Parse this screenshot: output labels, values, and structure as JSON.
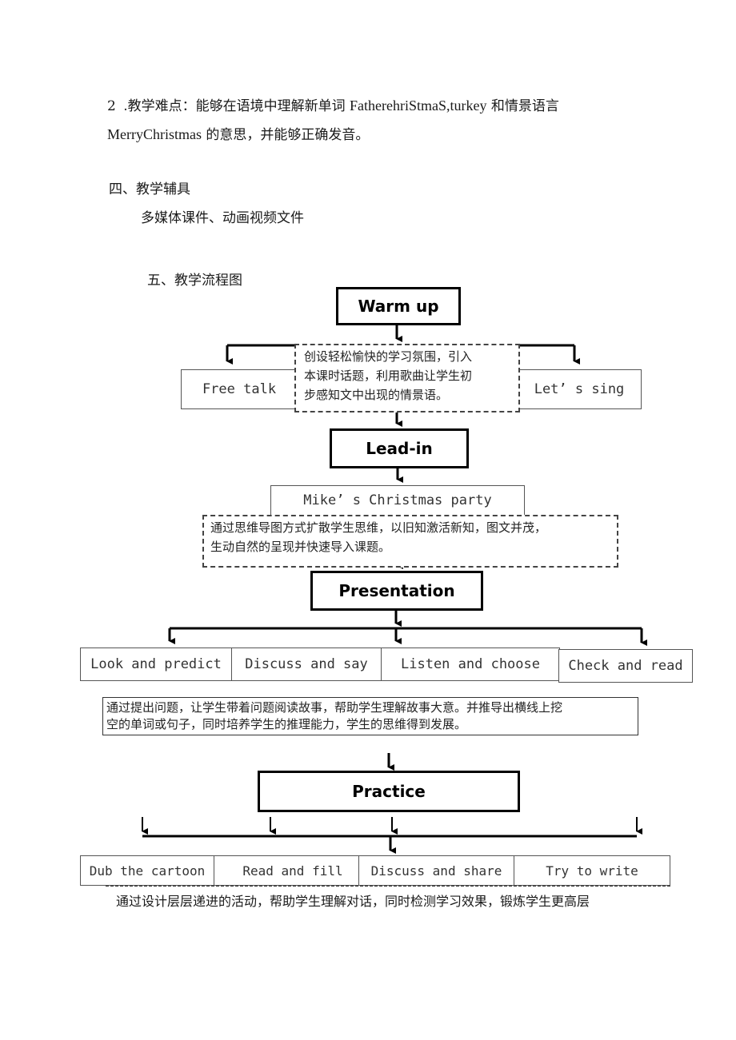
{
  "document": {
    "difficulty": {
      "number": "2",
      "line1_prefix": ".教学难点：能够在语境中理解新单词",
      "line1_words": "FatherehriStmaS,turkey",
      "line1_suffix": "和情景语言",
      "line2_words": "MerryChristmas",
      "line2_suffix": "的意思，并能够正确发音。"
    },
    "section4": {
      "heading": "四、教学辅具",
      "content": "多媒体课件、动画视频文件"
    },
    "section5": {
      "heading": "五、教学流程图"
    }
  },
  "flowchart": {
    "warmup": {
      "title": "Warm up",
      "activities": [
        "Free talk",
        "Let’ s sing"
      ],
      "note": [
        "创设轻松愉快的学习氛围，引入",
        "本课时话题，利用歌曲让学生初",
        "步感知文中出现的情景语。"
      ]
    },
    "leadin": {
      "title": "Lead-in",
      "activity": "Mike’ s Christmas party",
      "note": [
        "通过思维导图方式扩散学生思维，以旧知激活新知，图文并茂，",
        "生动自然的呈现并快速导入课题。"
      ]
    },
    "presentation": {
      "title": "Presentation",
      "activities": [
        "Look and predict",
        "Discuss and say",
        "Listen and choose",
        "Check and read"
      ],
      "note": [
        "通过提出问题，让学生带着问题阅读故事，帮助学生理解故事大意。并推导出横线上挖",
        "空的单词或句子，同时培养学生的推理能力，学生的思维得到发展。"
      ]
    },
    "practice": {
      "title": "Practice",
      "activities": [
        "Dub the cartoon",
        "Read and fill",
        "Discuss and share",
        "Try to write"
      ],
      "note": "通过设计层层递进的活动，帮助学生理解对话，同时检测学习效果，锻炼学生更高层"
    }
  }
}
